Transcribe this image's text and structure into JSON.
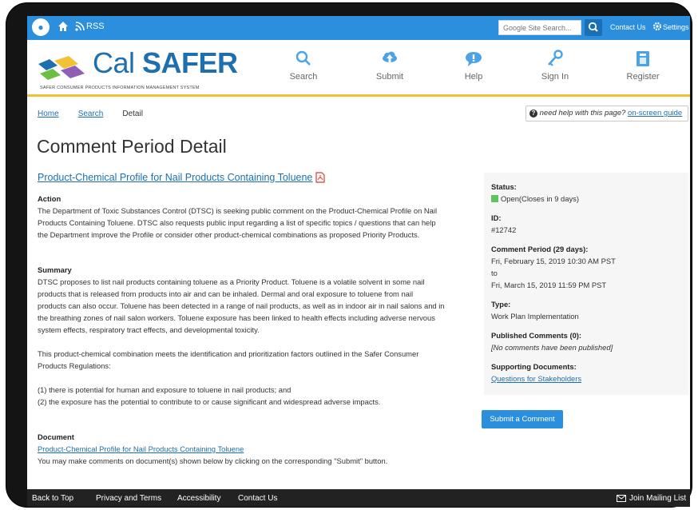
{
  "topbar": {
    "rss_label": "RSS",
    "search_placeholder": "Google Site Search...",
    "contact_label": "Contact Us",
    "settings_label": "Settings"
  },
  "header": {
    "brand_cal": "Cal",
    "brand_safer": "SAFER",
    "tagline": "SAFER CONSUMER PRODUCTS INFORMATION MANAGEMENT SYSTEM",
    "nav": [
      {
        "label": "Search",
        "icon": "search-icon"
      },
      {
        "label": "Submit",
        "icon": "cloud-upload-icon"
      },
      {
        "label": "Help",
        "icon": "chat-bubble-icon"
      },
      {
        "label": "Sign In",
        "icon": "key-icon"
      },
      {
        "label": "Register",
        "icon": "clipboard-icon"
      }
    ]
  },
  "breadcrumb": {
    "home": "Home",
    "search": "Search",
    "current": "Detail"
  },
  "help": {
    "text": "need help with this page?",
    "link": "on-screen guide"
  },
  "page": {
    "title": "Comment Period Detail",
    "profile_link": "Product-Chemical Profile for Nail Products Containing Toluene",
    "action_heading": "Action",
    "action_lines": [
      "The Department of Toxic Substances Control (DTSC) is seeking public comment on the Product-Chemical Profile on Nail",
      "Products Containing Toluene. DTSC also requests public input regarding a list of specific topics / questions that can help",
      "the Department improve the Profile or consider other product-chemical combinations as proposed Priority Products."
    ],
    "summary_heading": "Summary",
    "summary_lines": [
      "DTSC proposes to list nail products containing toluene as a Priority Product. Toluene is a volatile solvent in some nail",
      "products that is released from products into air and can be inhaled. Dermal and oral exposure to toluene from nail",
      "products can also occur. Toluene has been detected in a range of nail products, as well as in indoor air in nail salons and in",
      "the breathing zones of nail salon workers. Toluene exposure has been linked to health effects including adverse nervous",
      "system effects, respiratory tract effects, and developmental toxicity."
    ],
    "combination_lines": [
      "This product-chemical combination meets the identification and prioritization factors outlined in the Safer Consumer",
      "Products Regulations:"
    ],
    "factor_1": "(1) there is potential for human and exposure to toluene in nail products; and",
    "factor_2": "(2) the exposure has the potential to contribute to or cause significant and widespread adverse impacts.",
    "document_heading": "Document",
    "document_link": "Product-Chemical Profile for Nail Products Containing Toluene",
    "document_note": "You may make comments on document(s) shown below by clicking on the corresponding \"Submit\" button."
  },
  "sidebar": {
    "status_label": "Status:",
    "status_value": "Open(Closes in 9 days)",
    "status_color": "#5cc45c",
    "id_label": "ID:",
    "id_value": "#12742",
    "period_label": "Comment Period (29 days):",
    "period_start": "Fri, February 15, 2019 10:30 AM PST",
    "period_to": "to",
    "period_end": "Fri, March 15, 2019 11:59 PM PST",
    "type_label": "Type:",
    "type_value": "Work Plan Implementation",
    "published_label": "Published Comments (0):",
    "published_value": "[No comments have been published]",
    "supporting_label": "Supporting Documents:",
    "supporting_link": "Questions for Stakeholders",
    "submit_button": "Submit a Comment"
  },
  "footer": {
    "back_to_top": "Back to Top",
    "privacy": "Privacy and Terms",
    "accessibility": "Accessibility",
    "contact": "Contact Us",
    "mailing": "Join Mailing List"
  },
  "colors": {
    "topbar": "#2b8fdd",
    "brand": "#1e6fb0",
    "accent_line": "#f1c233",
    "footer": "#222222"
  }
}
